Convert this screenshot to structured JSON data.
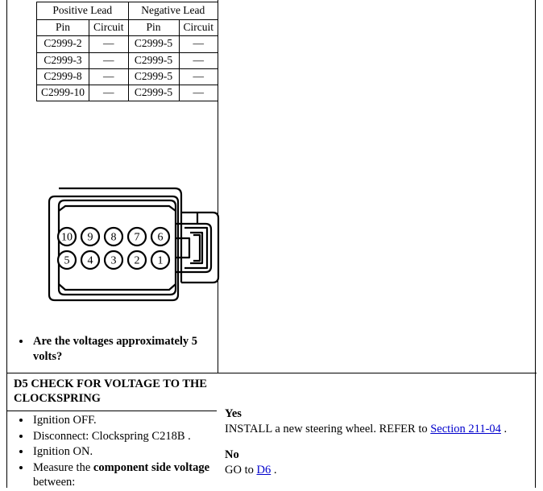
{
  "document": {
    "type": "automotive-diagnostic-pinpoint-test"
  },
  "pin_table": {
    "group_headers": [
      "Positive Lead",
      "Negative Lead"
    ],
    "column_headers": [
      "Pin",
      "Circuit",
      "Pin",
      "Circuit"
    ],
    "rows": [
      {
        "pos_pin": "C2999-2",
        "pos_circuit": "—",
        "neg_pin": "C2999-5",
        "neg_circuit": "—"
      },
      {
        "pos_pin": "C2999-3",
        "pos_circuit": "—",
        "neg_pin": "C2999-5",
        "neg_circuit": "—"
      },
      {
        "pos_pin": "C2999-8",
        "pos_circuit": "—",
        "neg_pin": "C2999-5",
        "neg_circuit": "—"
      },
      {
        "pos_pin": "C2999-10",
        "pos_circuit": "—",
        "neg_pin": "C2999-5",
        "neg_circuit": "—"
      }
    ]
  },
  "connector": {
    "name": "10-way-connector-pinout",
    "pin_labels_top": [
      "10",
      "9",
      "8",
      "7",
      "6"
    ],
    "pin_labels_bottom": [
      "5",
      "4",
      "3",
      "2",
      "1"
    ]
  },
  "question": {
    "items": [
      "Are the voltages approximately 5 volts?"
    ]
  },
  "d5_section": {
    "id": "D5",
    "title": "D5 CHECK FOR VOLTAGE TO THE CLOCKSPRING",
    "steps": [
      "Ignition OFF.",
      "Disconnect: Clockspring C218B .",
      "Ignition ON.",
      "Measure the component side voltage between:"
    ],
    "step4_prefix": "Measure the ",
    "step4_bold": "component side voltage",
    "step4_suffix": " between:"
  },
  "d5_results": {
    "yes_label": "Yes",
    "yes_text_before": "INSTALL a new steering wheel. REFER to ",
    "yes_link": "Section 211-04",
    "yes_text_after": " .",
    "no_label": "No",
    "no_text_before": "GO to ",
    "no_link": "D6",
    "no_text_after": " ."
  },
  "colors": {
    "link": "#0000cc",
    "border": "#000000",
    "background": "#ffffff"
  }
}
